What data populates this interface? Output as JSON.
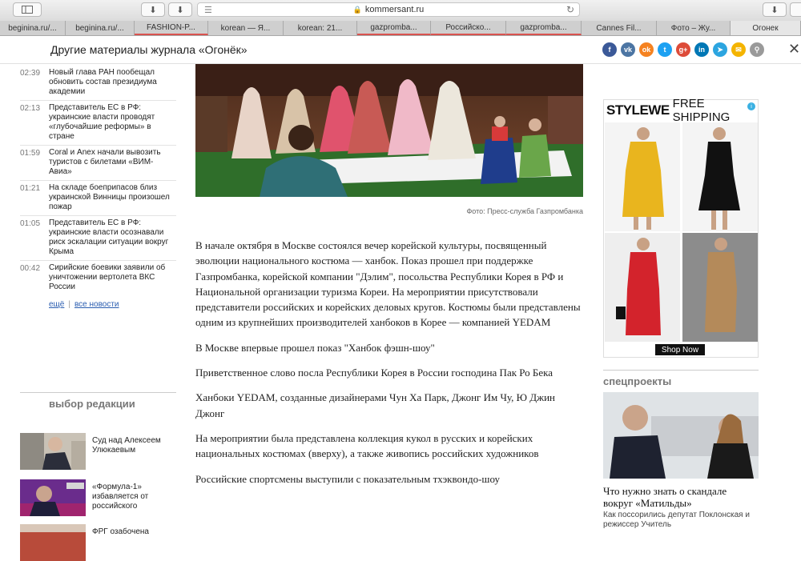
{
  "browser": {
    "url": "kommersant.ru",
    "tabs": [
      "beginina.ru/...",
      "beginina.ru/...",
      "FASHION-P...",
      "korean — Я...",
      "korean: 21...",
      "gazpromba...",
      "Российско...",
      "gazpromba...",
      "Cannes Fil...",
      "Фото – Жу...",
      "Огонек"
    ]
  },
  "header": {
    "title": "Другие материалы журнала «Огонёк»",
    "social_icons": [
      "facebook-icon",
      "vk-icon",
      "odnoklassniki-icon",
      "twitter-icon",
      "google-plus-icon",
      "linkedin-icon",
      "telegram-icon",
      "email-icon",
      "search-icon"
    ]
  },
  "news": [
    {
      "time": "02:39",
      "text": "Новый глава РАН пообещал обновить состав президиума академии"
    },
    {
      "time": "02:13",
      "text": "Представитель ЕС в РФ: украинские власти проводят «глубочайшие реформы» в стране"
    },
    {
      "time": "01:59",
      "text": "Coral и Anex начали вывозить туристов с билетами «ВИМ-Авиа»"
    },
    {
      "time": "01:21",
      "text": "На складе боеприпасов близ украинской Винницы произошел пожар"
    },
    {
      "time": "01:05",
      "text": "Представитель ЕС в РФ: украинские власти осознавали риск эскалации ситуации вокруг Крыма"
    },
    {
      "time": "00:42",
      "text": "Сирийские боевики заявили об уничтожении вертолета ВКС России"
    }
  ],
  "news_more": {
    "more": "ещё",
    "all": "все новости",
    "sep": "|"
  },
  "editor": {
    "title": "выбор редакции",
    "items": [
      {
        "text": "Суд над Алексеем Улюкаевым"
      },
      {
        "text": "«Формула-1» избавляется от российского"
      },
      {
        "text": "ФРГ озабочена"
      }
    ]
  },
  "photo_caption": "Фото: Пресс-служба Газпромбанка",
  "article": [
    "В начале октября в Москве состоялся вечер корейской культуры, посвященный эволюции национального костюма — ханбок. Показ прошел при поддержке Газпромбанка, корейской компании \"Дэлим\", посольства Республики Корея в РФ и Национальной организации туризма Кореи. На мероприятии присутствовали представители российских и корейских деловых кругов. Костюмы были представлены одним из крупнейших производителей ханбоков в Корее — компанией YEDAM",
    "В Москве впервые прошел показ \"Ханбок фэшн-шоу\"",
    "Приветственное слово посла Республики Корея в России господина Пак Ро Бека",
    "Ханбоки YEDAM, созданные дизайнерами Чун Ха Парк, Джонг Им Чу, Ю Джин Джонг",
    "На мероприятии была представлена коллекция кукол в русских и корейских национальных костюмах (вверху), а также живопись российских художников",
    "Российские спортсмены выступили с показательным тхэквондо-шоу"
  ],
  "ad": {
    "brand": "STYLEWE",
    "shipping": "FREE SHIPPING",
    "cta": "Shop Now"
  },
  "specprojects": {
    "title": "спецпроекты",
    "headline": "Что нужно знать о скандале вокруг «Матильды»",
    "sub": "Как поссорились депутат Поклонская и режиссер Учитель"
  }
}
